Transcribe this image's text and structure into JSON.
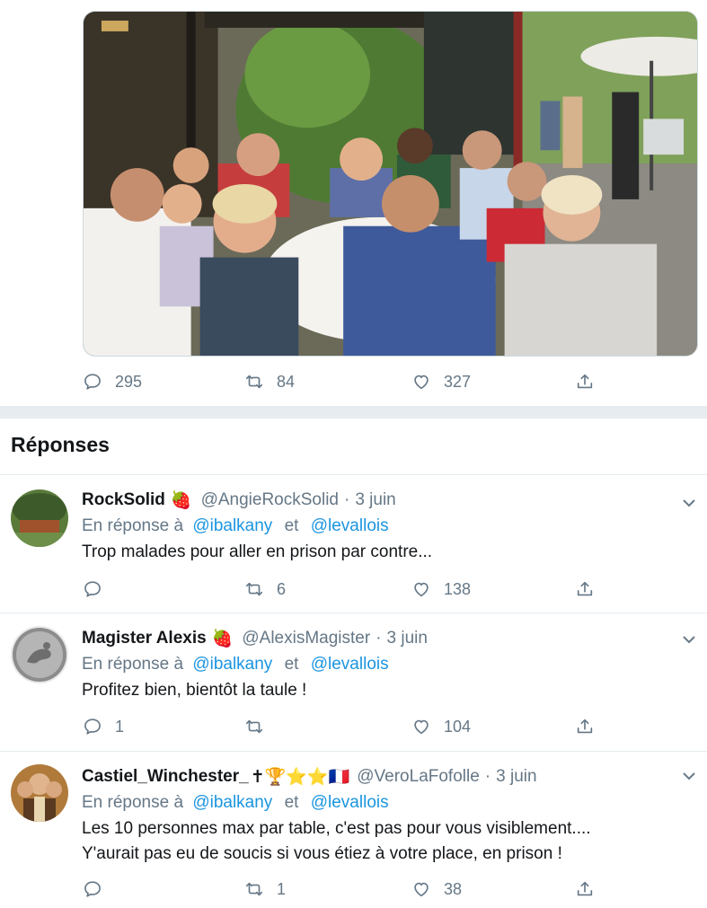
{
  "main_tweet": {
    "actions": {
      "replies": "295",
      "retweets": "84",
      "likes": "327",
      "reply_icon": "reply-icon",
      "retweet_icon": "retweet-icon",
      "like_icon": "heart-icon",
      "share_icon": "share-icon"
    }
  },
  "replies_section": {
    "title": "Réponses",
    "items": [
      {
        "name": "RockSolid",
        "badges": "🍓",
        "handle": "@AngieRockSolid",
        "separator": "·",
        "date": "3 juin",
        "in_reply_prefix": "En réponse à",
        "mention_1": "@ibalkany",
        "joiner": "et",
        "mention_2": "@levallois",
        "text_lines": [
          "Trop malades pour aller en prison par contre..."
        ],
        "replies": "",
        "retweets": "6",
        "likes": "138"
      },
      {
        "name": "Magister Alexis",
        "badges": "🍓",
        "handle": "@AlexisMagister",
        "separator": "·",
        "date": "3 juin",
        "in_reply_prefix": "En réponse à",
        "mention_1": "@ibalkany",
        "joiner": "et",
        "mention_2": "@levallois",
        "text_lines": [
          "Profitez bien, bientôt la taule !"
        ],
        "replies": "1",
        "retweets": "",
        "likes": "104"
      },
      {
        "name": "Castiel_Winchester_",
        "badges": "✝🏆⭐⭐🇫🇷",
        "handle": "@VeroLaFofolle",
        "separator": "·",
        "date": "3 juin",
        "in_reply_prefix": "En réponse à",
        "mention_1": "@ibalkany",
        "joiner": "et",
        "mention_2": "@levallois",
        "text_lines": [
          "Les 10 personnes max par table, c'est pas pour vous visiblement....",
          "Y'aurait pas eu de soucis si vous étiez à votre place, en prison !"
        ],
        "replies": "",
        "retweets": "1",
        "likes": "38"
      }
    ]
  },
  "colors": {
    "link": "#1b95e0",
    "secondary_text": "#657786",
    "divider": "#e6ecf0"
  }
}
